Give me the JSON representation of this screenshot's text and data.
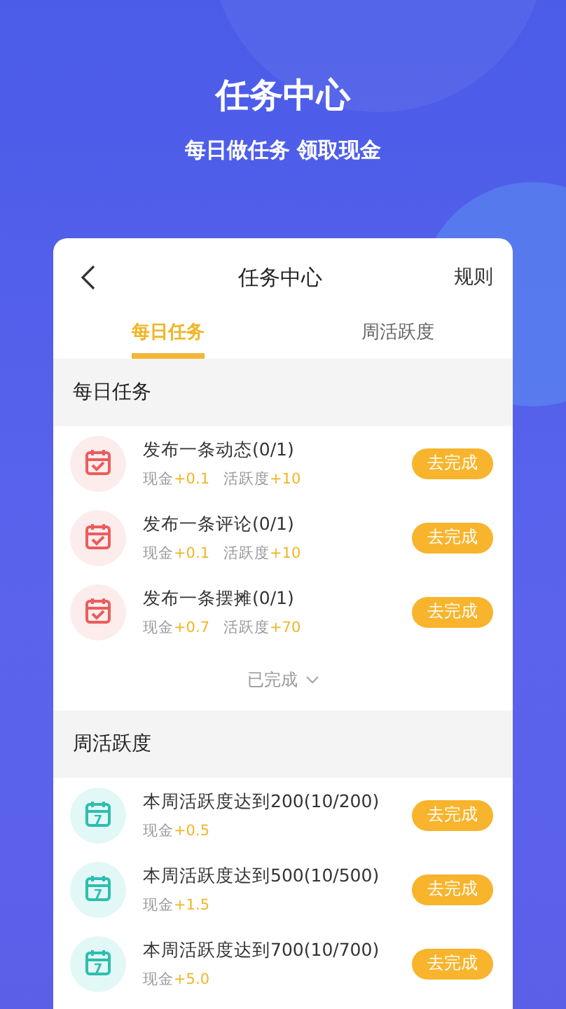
{
  "header": {
    "title": "任务中心",
    "subtitle": "每日做任务 领取现金"
  },
  "card": {
    "title": "任务中心",
    "rules": "规则"
  },
  "tabs": [
    {
      "label": "每日任务",
      "selected": true
    },
    {
      "label": "周活跃度",
      "selected": false
    }
  ],
  "sections": [
    {
      "title": "每日任务",
      "footer": "已完成",
      "tasks": [
        {
          "kind": "check",
          "name": "发布一条动态(0/1)",
          "rewards": [
            {
              "label": "现金",
              "value": "+0.1"
            },
            {
              "label": "活跃度",
              "value": "+10"
            }
          ],
          "button": "去完成"
        },
        {
          "kind": "check",
          "name": "发布一条评论(0/1)",
          "rewards": [
            {
              "label": "现金",
              "value": "+0.1"
            },
            {
              "label": "活跃度",
              "value": "+10"
            }
          ],
          "button": "去完成"
        },
        {
          "kind": "check",
          "name": "发布一条摆摊(0/1)",
          "rewards": [
            {
              "label": "现金",
              "value": "+0.7"
            },
            {
              "label": "活跃度",
              "value": "+70"
            }
          ],
          "button": "去完成"
        }
      ]
    },
    {
      "title": "周活跃度",
      "tasks": [
        {
          "kind": "week",
          "badge": "7",
          "name": "本周活跃度达到200(10/200)",
          "rewards": [
            {
              "label": "现金",
              "value": "+0.5"
            }
          ],
          "button": "去完成"
        },
        {
          "kind": "week",
          "badge": "7",
          "name": "本周活跃度达到500(10/500)",
          "rewards": [
            {
              "label": "现金",
              "value": "+1.5"
            }
          ],
          "button": "去完成"
        },
        {
          "kind": "week",
          "badge": "7",
          "name": "本周活跃度达到700(10/700)",
          "rewards": [
            {
              "label": "现金",
              "value": "+5.0"
            }
          ],
          "button": "去完成"
        }
      ]
    }
  ]
}
